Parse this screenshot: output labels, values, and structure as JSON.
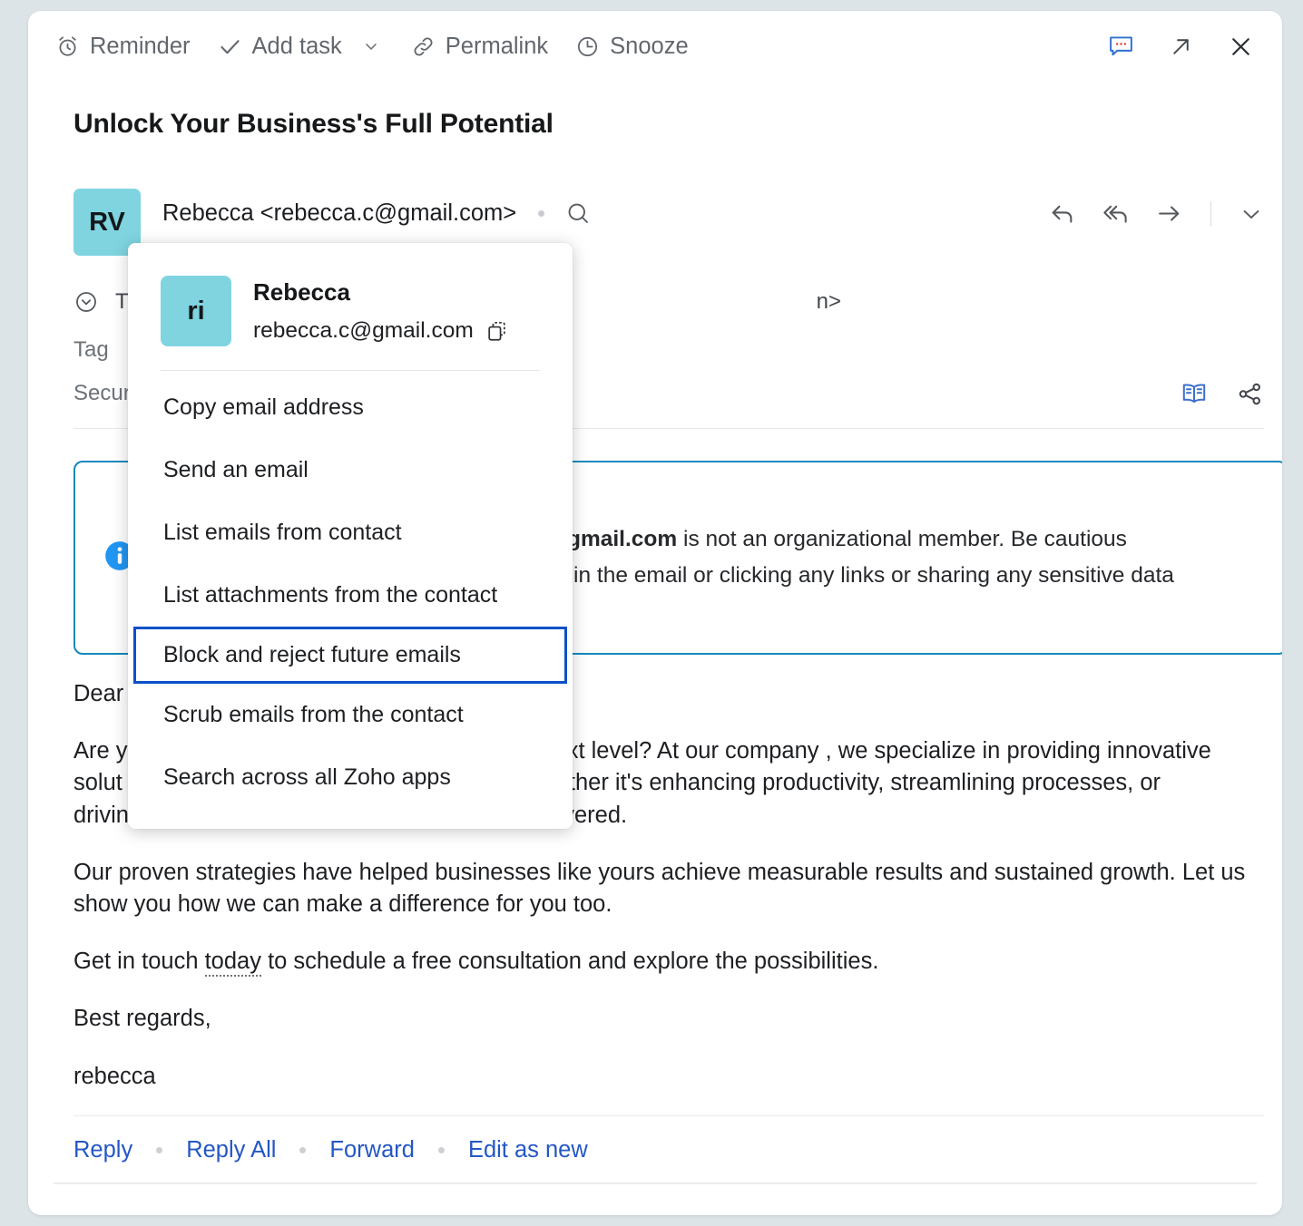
{
  "toolbar": {
    "items": [
      {
        "label": "Reminder",
        "icon": "alarm-clock-icon"
      },
      {
        "label": "Add task",
        "icon": "check-icon"
      },
      {
        "label": "Permalink",
        "icon": "link-icon"
      },
      {
        "label": "Snooze",
        "icon": "clock-icon"
      }
    ],
    "right_icons": [
      {
        "name": "comment-icon"
      },
      {
        "name": "open-in-new-icon"
      },
      {
        "name": "close-icon"
      }
    ]
  },
  "subject": "Unlock Your Business's Full Potential",
  "sender": {
    "avatar_initials": "RV",
    "display": "Rebecca <rebecca.c@gmail.com>",
    "actions": [
      {
        "name": "reply-icon"
      },
      {
        "name": "reply-all-icon"
      },
      {
        "name": "forward-icon"
      },
      {
        "name": "chevron-down-icon"
      }
    ]
  },
  "meta": {
    "to_label": "T",
    "to_value": "n>",
    "tags_label": "Tag",
    "security_label": "Securit",
    "icons": [
      {
        "name": "reading-mode-icon"
      },
      {
        "name": "share-icon"
      }
    ]
  },
  "banner": {
    "icon": "info-icon",
    "bold_fragment": "gmail.com",
    "line1_rest": " is not an organizational member. Be cautious",
    "line2": "s in the email or clicking any links or sharing any sensitive data"
  },
  "body": {
    "greeting": "Dear",
    "p1_a": "Are y",
    "p1_b": "ext level? At our company , we specialize in providing innovative",
    "p1_c": "solut",
    "p1_d": "ther it's enhancing productivity, streamlining processes, or",
    "p1_e": "driving customer engagement, we've got you covered.",
    "p2": "Our proven strategies have helped businesses like yours achieve measurable results and sustained growth. Let us show you how we can make a difference for you too.",
    "p3_a": "Get in touch ",
    "p3_link": "today",
    "p3_b": " to schedule a free consultation and explore the possibilities.",
    "p4": "Best regards,",
    "p5": "rebecca"
  },
  "footer": {
    "reply": "Reply",
    "reply_all": "Reply All",
    "forward": "Forward",
    "edit_as_new": "Edit as new"
  },
  "context_menu": {
    "contact": {
      "avatar_initials": "ri",
      "name": "Rebecca",
      "email": "rebecca.c@gmail.com",
      "copy_icon": "copy-icon"
    },
    "items": [
      {
        "label": "Copy email address",
        "selected": false
      },
      {
        "label": "Send an email",
        "selected": false
      },
      {
        "label": "List emails from contact",
        "selected": false
      },
      {
        "label": "List attachments from the contact",
        "selected": false
      },
      {
        "label": "Block and reject future emails",
        "selected": true
      },
      {
        "label": "Scrub emails from the contact",
        "selected": false
      },
      {
        "label": "Search across all Zoho apps",
        "selected": false
      }
    ]
  },
  "colors": {
    "page_bg": "#dce4e8",
    "avatar_teal": "#7fd4e0",
    "banner_border": "#1389bd",
    "info_blue": "#2196f3",
    "link_blue": "#2457c5",
    "selection_blue": "#0b50c8",
    "reading_icon_blue": "#3d6fce"
  }
}
